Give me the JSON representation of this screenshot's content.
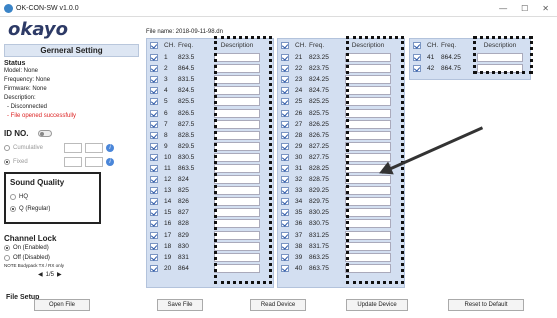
{
  "window": {
    "title": "OK-CON-SW v1.0.0",
    "min": "—",
    "max": "☐",
    "close": "✕"
  },
  "logo": "okayo",
  "sidebar": {
    "heading": "Gerneral Setting",
    "status_label": "Status",
    "model": "Model: None",
    "frequency": "Frequency: None",
    "firmware": "Firmware: None",
    "description_label": "Description:",
    "desc_line1": "- Disconnected",
    "desc_line2": "- File opened successfully",
    "idno_label": "ID NO.",
    "cumulative": "Cumulative",
    "fixed": "Fixed",
    "sound_label": "Sound Quality",
    "hq": "HQ",
    "q": "Q (Regular)",
    "lock_label": "Channel Lock",
    "lock_on": "On (Enabled)",
    "lock_off": "Off (Disabled)",
    "note": "NOTE Bodypack TX / RX only",
    "page": "1/5",
    "file_setup": "File Setup"
  },
  "file_name": "File name: 2018-09-11-98.dn",
  "headers": {
    "ch": "CH.",
    "freq": "Freq.",
    "desc": "Description"
  },
  "table1": [
    {
      "ch": "1",
      "f": "823.5"
    },
    {
      "ch": "2",
      "f": "864.5"
    },
    {
      "ch": "3",
      "f": "831.5"
    },
    {
      "ch": "4",
      "f": "824.5"
    },
    {
      "ch": "5",
      "f": "825.5"
    },
    {
      "ch": "6",
      "f": "826.5"
    },
    {
      "ch": "7",
      "f": "827.5"
    },
    {
      "ch": "8",
      "f": "828.5"
    },
    {
      "ch": "9",
      "f": "829.5"
    },
    {
      "ch": "10",
      "f": "830.5"
    },
    {
      "ch": "11",
      "f": "863.5"
    },
    {
      "ch": "12",
      "f": "824"
    },
    {
      "ch": "13",
      "f": "825"
    },
    {
      "ch": "14",
      "f": "826"
    },
    {
      "ch": "15",
      "f": "827"
    },
    {
      "ch": "16",
      "f": "828"
    },
    {
      "ch": "17",
      "f": "829"
    },
    {
      "ch": "18",
      "f": "830"
    },
    {
      "ch": "19",
      "f": "831"
    },
    {
      "ch": "20",
      "f": "864"
    }
  ],
  "table2": [
    {
      "ch": "21",
      "f": "823.25"
    },
    {
      "ch": "22",
      "f": "823.75"
    },
    {
      "ch": "23",
      "f": "824.25"
    },
    {
      "ch": "24",
      "f": "824.75"
    },
    {
      "ch": "25",
      "f": "825.25"
    },
    {
      "ch": "26",
      "f": "825.75"
    },
    {
      "ch": "27",
      "f": "826.25"
    },
    {
      "ch": "28",
      "f": "826.75"
    },
    {
      "ch": "29",
      "f": "827.25"
    },
    {
      "ch": "30",
      "f": "827.75"
    },
    {
      "ch": "31",
      "f": "828.25"
    },
    {
      "ch": "32",
      "f": "828.75"
    },
    {
      "ch": "33",
      "f": "829.25"
    },
    {
      "ch": "34",
      "f": "829.75"
    },
    {
      "ch": "35",
      "f": "830.25"
    },
    {
      "ch": "36",
      "f": "830.75"
    },
    {
      "ch": "37",
      "f": "831.25"
    },
    {
      "ch": "38",
      "f": "831.75"
    },
    {
      "ch": "39",
      "f": "863.25"
    },
    {
      "ch": "40",
      "f": "863.75"
    }
  ],
  "table3": [
    {
      "ch": "41",
      "f": "864.25"
    },
    {
      "ch": "42",
      "f": "864.75"
    }
  ],
  "buttons": {
    "open": "Open File",
    "save": "Save File",
    "read": "Read Device",
    "update": "Update Device",
    "reset": "Reset to Default"
  }
}
